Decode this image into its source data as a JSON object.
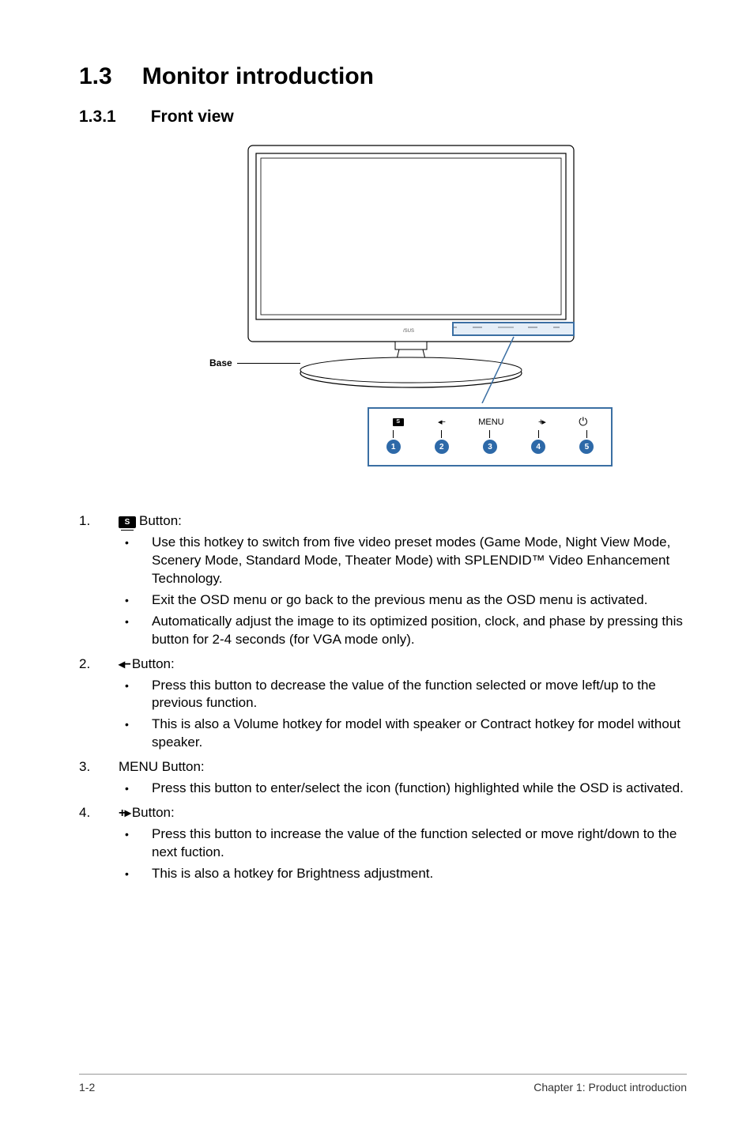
{
  "heading": {
    "num": "1.3",
    "title": "Monitor introduction"
  },
  "subheading": {
    "num": "1.3.1",
    "title": "Front view"
  },
  "figure": {
    "base_label": "Base",
    "callout_menu": "MENU",
    "numbers": [
      "1",
      "2",
      "3",
      "4",
      "5"
    ]
  },
  "items": [
    {
      "num": "1.",
      "icon": "s-icon",
      "label_suffix": " Button:",
      "bullets": [
        "Use this hotkey to switch from five video preset modes (Game Mode, Night View Mode, Scenery Mode, Standard Mode, Theater Mode) with SPLENDID™ Video Enhancement Technology.",
        "Exit the OSD menu or go back to the previous menu as the OSD menu is activated.",
        "Automatically adjust the image to its optimized position, clock, and phase by pressing this button for 2-4 seconds (for VGA mode only)."
      ]
    },
    {
      "num": "2.",
      "icon": "arrow-left",
      "label_suffix": " Button:",
      "bullets": [
        "Press this button to decrease the value of the function selected or move left/up to the previous function.",
        "This is also a Volume hotkey for model with speaker or Contract hotkey for model without speaker."
      ]
    },
    {
      "num": "3.",
      "icon": "none",
      "label_prefix": "MENU Button:",
      "bullets": [
        "Press this button to enter/select the icon (function) highlighted while the OSD is activated."
      ]
    },
    {
      "num": "4.",
      "icon": "arrow-right",
      "label_suffix": " Button:",
      "bullets": [
        "Press this button to increase the value of the function selected or move right/down to the next fuction.",
        "This is also a hotkey for Brightness adjustment."
      ]
    }
  ],
  "footer": {
    "left": "1-2",
    "right": "Chapter 1: Product introduction"
  }
}
